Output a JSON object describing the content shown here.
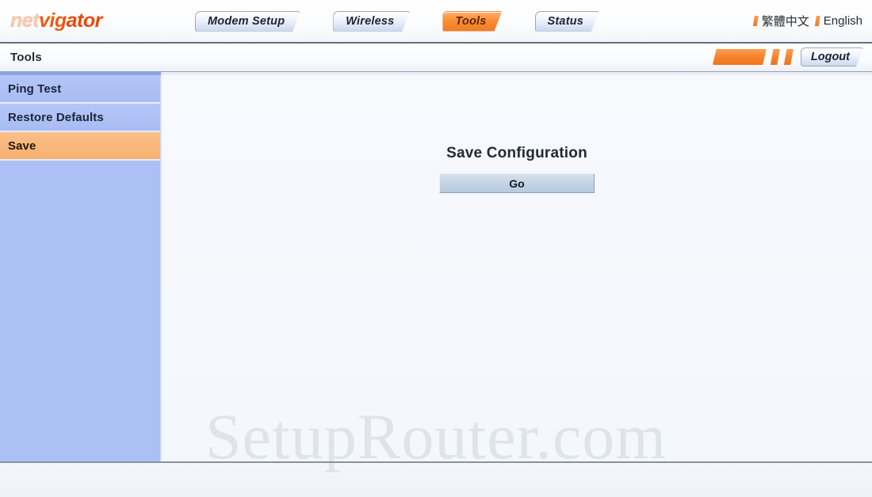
{
  "brand": {
    "logo_part1": "net",
    "logo_part2": "vig",
    "logo_part3": "ator"
  },
  "nav": {
    "tabs": [
      {
        "label": "Modem Setup",
        "active": false
      },
      {
        "label": "Wireless",
        "active": false
      },
      {
        "label": "Tools",
        "active": true
      },
      {
        "label": "Status",
        "active": false
      }
    ]
  },
  "language": {
    "chinese": "繁體中文",
    "english": "English"
  },
  "section": {
    "title": "Tools",
    "logout_label": "Logout"
  },
  "sidebar": {
    "items": [
      {
        "label": "Ping Test",
        "selected": false
      },
      {
        "label": "Restore Defaults",
        "selected": false
      },
      {
        "label": "Save",
        "selected": true
      }
    ]
  },
  "main": {
    "heading": "Save Configuration",
    "go_label": "Go"
  },
  "watermark": {
    "text": "SetupRouter.com"
  },
  "colors": {
    "accent_orange": "#f07c25",
    "sidebar_blue": "#adc0f5",
    "selected_orange": "#f8b77c",
    "tab_blue": "#ccd8ef"
  }
}
